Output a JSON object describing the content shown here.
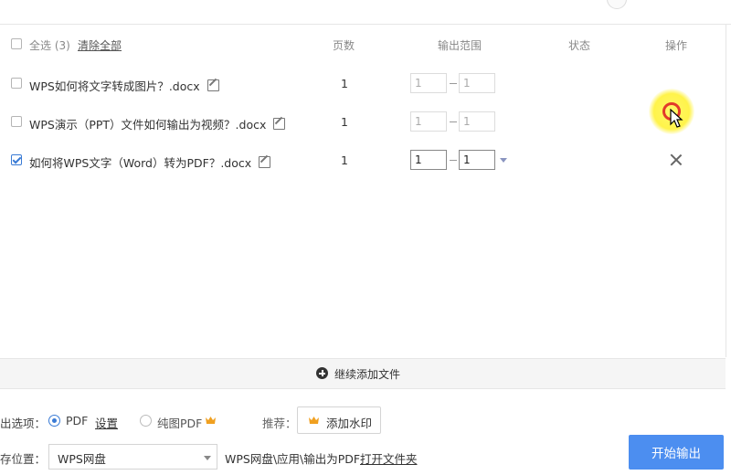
{
  "header": {
    "select_all": "全选 (3)",
    "clear_all": "清除全部",
    "col_pages": "页数",
    "col_range": "输出范围",
    "col_status": "状态",
    "col_actions": "操作"
  },
  "files": [
    {
      "name": "WPS如何将文字转成图片？.docx",
      "pages": "1",
      "from": "1",
      "to": "1",
      "checked": false
    },
    {
      "name": "WPS演示（PPT）文件如何输出为视频？.docx",
      "pages": "1",
      "from": "1",
      "to": "1",
      "checked": false
    },
    {
      "name": "如何将WPS文字（Word）转为PDF？.docx",
      "pages": "1",
      "from": "1",
      "to": "1",
      "checked": true
    }
  ],
  "add_files": "继续添加文件",
  "options": {
    "label": "出选项：",
    "pdf": "PDF",
    "settings": "设置",
    "image_pdf": "纯图PDF",
    "recommend": "推荐：",
    "watermark": "添加水印"
  },
  "save": {
    "label": "存位置：",
    "location": "WPS网盘",
    "path": "WPS网盘\\应用\\输出为PDF",
    "open_folder": "打开文件夹"
  },
  "start_button": "开始输出",
  "colors": {
    "accent": "#4c8ef0",
    "crown": "#f0a020",
    "highlight": "#fff34a",
    "ring": "#e23a2a"
  }
}
